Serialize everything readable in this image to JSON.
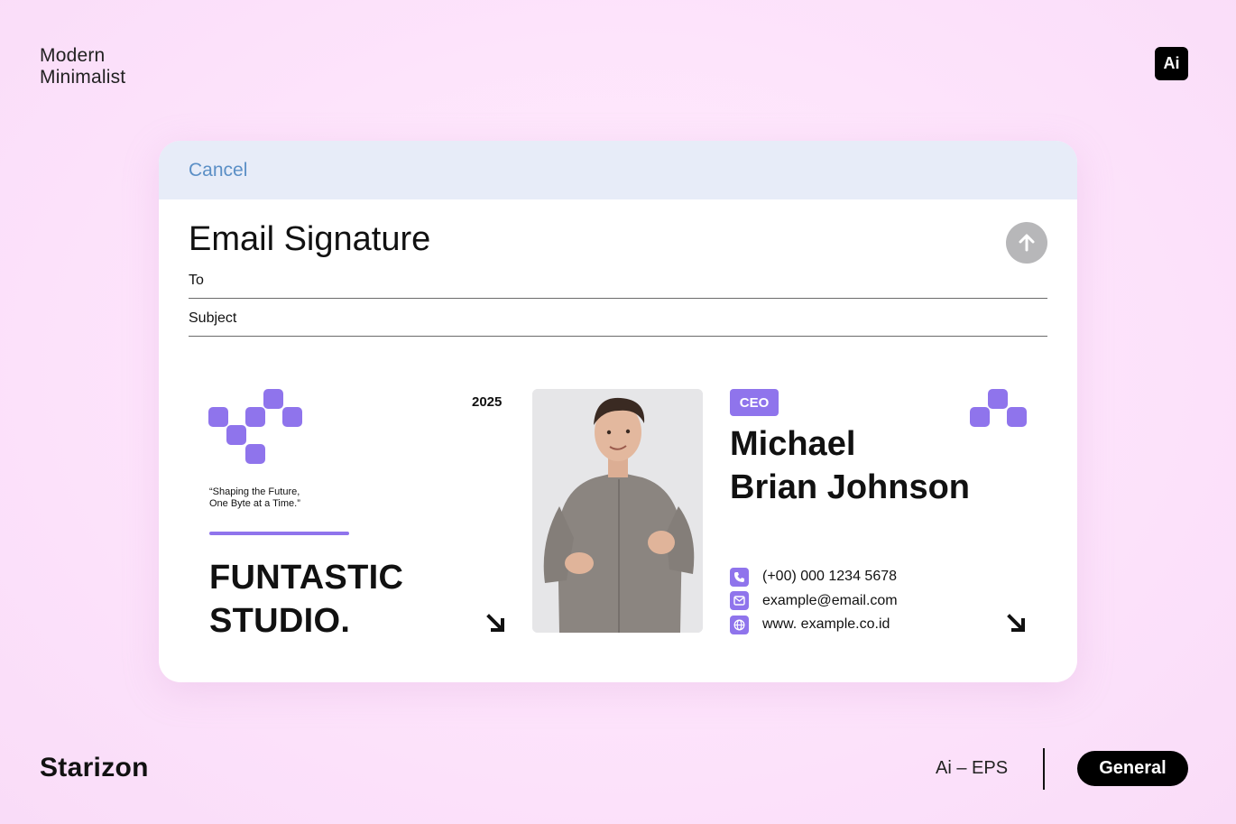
{
  "header": {
    "title_line1": "Modern",
    "title_line2": "Minimalist",
    "app_badge": "Ai"
  },
  "footer": {
    "brand": "Starizon",
    "formats": "Ai – EPS",
    "category": "General"
  },
  "composer": {
    "cancel_label": "Cancel",
    "title": "Email Signature",
    "to_label": "To",
    "subject_label": "Subject",
    "send_icon": "arrow-up-icon"
  },
  "signature": {
    "quote_line1": "“Shaping the Future,",
    "quote_line2": "One Byte at a Time.”",
    "studio_line1": "FUNTASTIC",
    "studio_line2": "STUDIO.",
    "year": "2025",
    "role": "CEO",
    "name_line1": "Michael",
    "name_line2": "Brian Johnson",
    "phone": "(+00) 000 1234 5678",
    "email": "example@email.com",
    "website": "www. example.co.id",
    "accent_color": "#8f74ec"
  },
  "colors": {
    "background": "#ffe5fc",
    "card_header": "#e7ecf8",
    "link": "#5b8fc6",
    "send_button": "#b7b7b9"
  }
}
